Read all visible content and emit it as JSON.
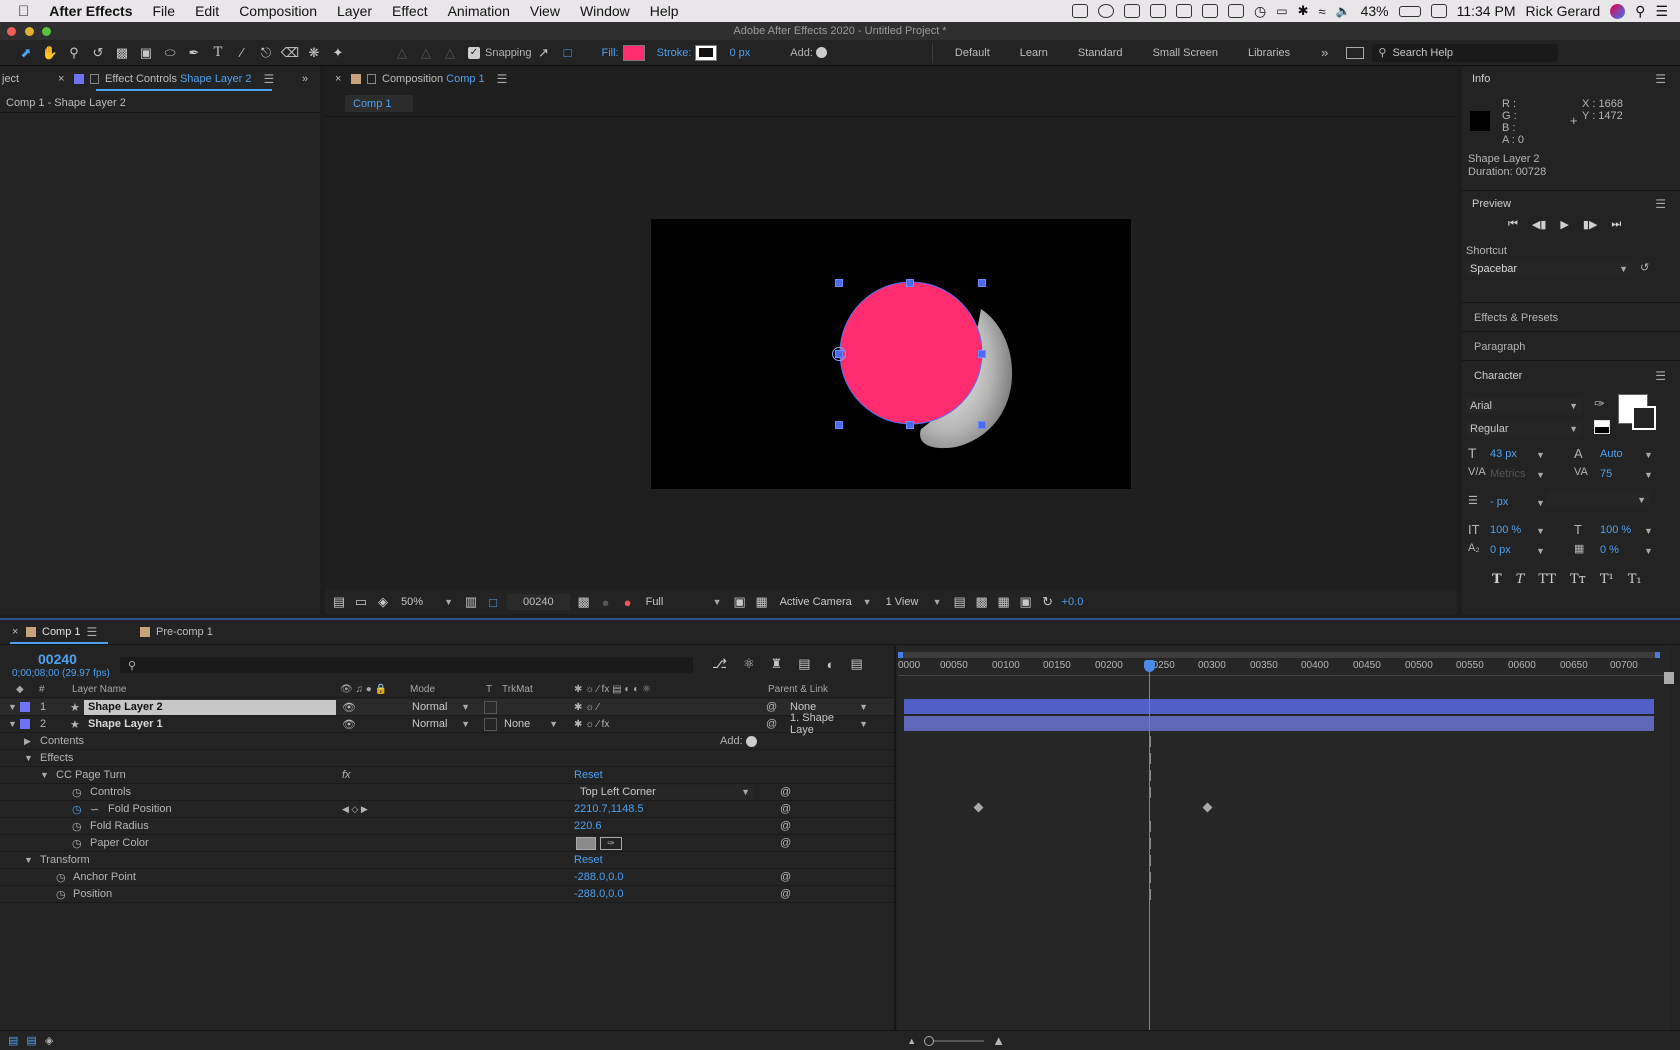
{
  "menubar": {
    "app": "After Effects",
    "items": [
      "File",
      "Edit",
      "Composition",
      "Layer",
      "Effect",
      "Animation",
      "View",
      "Window",
      "Help"
    ],
    "battery": "43%",
    "time": "11:34 PM",
    "user": "Rick Gerard"
  },
  "window_title": "Adobe After Effects 2020 - Untitled Project *",
  "toolbar": {
    "snapping": "Snapping",
    "fill_label": "Fill:",
    "stroke_label": "Stroke:",
    "stroke_px": "0 px",
    "add_label": "Add:",
    "workspaces": [
      "Default",
      "Learn",
      "Standard",
      "Small Screen",
      "Libraries"
    ],
    "search_placeholder": "Search Help",
    "fill_color": "#ff2d6f"
  },
  "left_panel": {
    "tab_project": "ject",
    "tab_effect": "Effect Controls",
    "tab_effect_layer": "Shape Layer 2",
    "breadcrumb": "Comp 1 - Shape Layer 2"
  },
  "comp_panel": {
    "tab_label": "Composition",
    "tab_comp": "Comp 1",
    "sub_tab": "Comp 1",
    "zoom": "50%",
    "timecode": "00240",
    "resolution": "Full",
    "camera": "Active Camera",
    "view": "1 View",
    "exposure": "+0.0"
  },
  "info_panel": {
    "title": "Info",
    "r": "R :",
    "g": "G :",
    "b": "B :",
    "a": "A :  0",
    "x": "X : 1668",
    "y": "Y : 1472",
    "layer": "Shape Layer 2",
    "duration": "Duration: 00728"
  },
  "preview_panel": {
    "title": "Preview",
    "shortcut_label": "Shortcut",
    "shortcut_value": "Spacebar"
  },
  "effects_presets": "Effects & Presets",
  "paragraph": "Paragraph",
  "character": {
    "title": "Character",
    "font": "Arial",
    "style": "Regular",
    "size": "43 px",
    "leading": "Auto",
    "kerning": "Metrics",
    "tracking": "75",
    "stroke_px": "- px",
    "vscale": "100 %",
    "hscale": "100 %",
    "baseline": "0 px",
    "tsume": "0 %"
  },
  "timeline": {
    "tab_comp": "Comp 1",
    "tab_precomp": "Pre-comp 1",
    "timecode": "00240",
    "timecode_sub": "0;00;08;00 (29.97 fps)",
    "headers": {
      "num": "#",
      "layer_name": "Layer Name",
      "mode": "Mode",
      "t": "T",
      "trkmat": "TrkMat",
      "parent": "Parent & Link"
    },
    "ruler": [
      "0000",
      "00050",
      "00100",
      "00150",
      "00200",
      "00250",
      "00300",
      "00350",
      "00400",
      "00450",
      "00500",
      "00550",
      "00600",
      "00650",
      "00700"
    ],
    "layers": [
      {
        "num": "1",
        "name": "Shape Layer 2",
        "mode": "Normal",
        "trkmat": "",
        "parent": "None"
      },
      {
        "num": "2",
        "name": "Shape Layer 1",
        "mode": "Normal",
        "trkmat": "None",
        "parent": "1. Shape Laye"
      }
    ],
    "props": {
      "contents": "Contents",
      "add": "Add:",
      "effects": "Effects",
      "cc_page_turn": "CC Page Turn",
      "reset": "Reset",
      "controls": "Controls",
      "controls_value": "Top Left Corner",
      "fold_position": "Fold Position",
      "fold_position_value": "2210.7,1148.5",
      "fold_radius": "Fold Radius",
      "fold_radius_value": "220.6",
      "paper_color": "Paper Color",
      "transform": "Transform",
      "transform_reset": "Reset",
      "anchor_point": "Anchor Point",
      "anchor_point_value": "-288.0,0.0",
      "position": "Position",
      "position_value": "-288.0,0.0"
    }
  }
}
